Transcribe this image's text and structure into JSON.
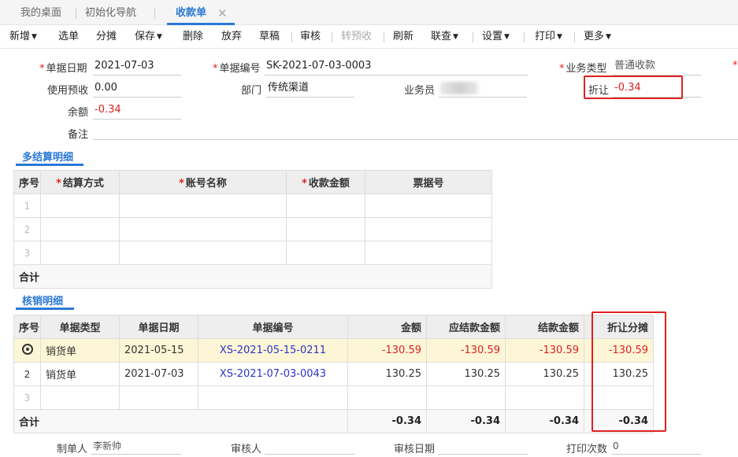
{
  "tabs": [
    {
      "label": "我的桌面"
    },
    {
      "label": "初始化导航"
    },
    {
      "label": "收款单"
    }
  ],
  "tab_close": "✕",
  "toolbar": {
    "new": "新增",
    "select": "选单",
    "split": "分摊",
    "save": "保存",
    "delete": "删除",
    "abandon": "放弃",
    "draft": "草稿",
    "audit": "审核",
    "to_prepay": "转预收",
    "refresh": "刷新",
    "link": "联查",
    "settings": "设置",
    "print": "打印",
    "more": "更多"
  },
  "form": {
    "doc_date_label": "单据日期",
    "doc_date": "2021-07-03",
    "doc_no_label": "单据编号",
    "doc_no": "SK-2021-07-03-0003",
    "biz_type_label": "业务类型",
    "biz_type": "普通收款",
    "use_prepay_label": "使用预收",
    "use_prepay": "0.00",
    "dept_label": "部门",
    "dept": "传统渠道",
    "salesman_label": "业务员",
    "discount_label": "折让",
    "discount": "-0.34",
    "balance_label": "余额",
    "balance": "-0.34",
    "note_label": "备注",
    "note": ""
  },
  "settle_section": {
    "title": "多结算明细",
    "headers": [
      "序号",
      "结算方式",
      "账号名称",
      "收款金额",
      "票据号"
    ],
    "rows": [
      {
        "idx": "1"
      },
      {
        "idx": "2"
      },
      {
        "idx": "3"
      }
    ],
    "total_label": "合计"
  },
  "verify_section": {
    "title": "核销明细",
    "headers": [
      "序号",
      "单据类型",
      "单据日期",
      "单据编号",
      "金额",
      "应结款金额",
      "结款金额",
      "折让分摊"
    ],
    "rows": [
      {
        "idx": "",
        "type": "销货单",
        "date": "2021-05-15",
        "no": "XS-2021-05-15-0211",
        "amount": "-130.59",
        "due": "-130.59",
        "paid": "-130.59",
        "discount": "-130.59"
      },
      {
        "idx": "2",
        "type": "销货单",
        "date": "2021-07-03",
        "no": "XS-2021-07-03-0043",
        "amount": "130.25",
        "due": "130.25",
        "paid": "130.25",
        "discount": "130.25"
      },
      {
        "idx": "3",
        "type": "",
        "date": "",
        "no": "",
        "amount": "",
        "due": "",
        "paid": "",
        "discount": ""
      }
    ],
    "total_label": "合计",
    "totals": {
      "amount": "-0.34",
      "due": "-0.34",
      "paid": "-0.34",
      "discount": "-0.34"
    }
  },
  "footer": {
    "maker_label": "制单人",
    "maker": "李新帅",
    "auditor_label": "审核人",
    "auditor": "",
    "audit_date_label": "审核日期",
    "audit_date": "",
    "print_count_label": "打印次数",
    "print_count": "0"
  },
  "colors": {
    "accent": "#2a78d6",
    "negative": "#e02020",
    "highlight_row": "#fdf6d6",
    "link": "#2b36c9"
  }
}
